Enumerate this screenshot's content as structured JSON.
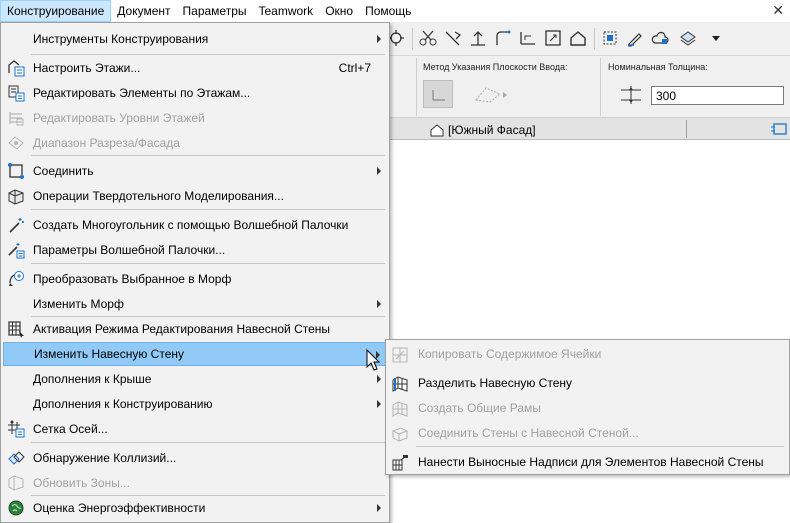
{
  "menubar": {
    "items": [
      {
        "label": "Конструирование"
      },
      {
        "label": "Документ"
      },
      {
        "label": "Параметры"
      },
      {
        "label": "Teamwork"
      },
      {
        "label": "Окно"
      },
      {
        "label": "Помощь"
      }
    ],
    "close_glyph": "✕"
  },
  "menu": {
    "items": [
      {
        "label": "Инструменты Конструирования",
        "icon": "none",
        "submenu": true
      },
      {
        "label": "Настроить Этажи...",
        "shortcut": "Ctrl+7",
        "icon": "stories-icon"
      },
      {
        "label": "Редактировать Элементы по Этажам...",
        "icon": "edit-by-story-icon"
      },
      {
        "label": "Редактировать Уровни Этажей",
        "icon": "story-levels-icon",
        "disabled": true
      },
      {
        "label": "Диапазон Разреза/Фасада",
        "icon": "section-range-icon",
        "disabled": true
      },
      {
        "label": "Соединить",
        "icon": "connect-icon",
        "submenu": true
      },
      {
        "label": "Операции Твердотельного Моделирования...",
        "icon": "solid-ops-icon"
      },
      {
        "label": "Создать Многоугольник с помощью Волшебной Палочки",
        "icon": "magic-wand-icon"
      },
      {
        "label": "Параметры Волшебной Палочки...",
        "icon": "magic-wand-settings-icon"
      },
      {
        "label": "Преобразовать Выбранное в Морф",
        "icon": "morph-convert-icon"
      },
      {
        "label": "Изменить Морф",
        "icon": "none",
        "submenu": true
      },
      {
        "label": "Активация Режима Редактирования Навесной Стены",
        "icon": "curtain-wall-edit-icon"
      },
      {
        "label": "Изменить Навесную Стену",
        "icon": "none",
        "submenu": true,
        "highlighted": true
      },
      {
        "label": "Дополнения к Крыше",
        "icon": "none",
        "submenu": true
      },
      {
        "label": "Дополнения к Конструированию",
        "icon": "none",
        "submenu": true
      },
      {
        "label": "Сетка Осей...",
        "icon": "grid-icon"
      },
      {
        "label": "Обнаружение Коллизий...",
        "icon": "collision-icon"
      },
      {
        "label": "Обновить Зоны...",
        "icon": "zones-icon",
        "disabled": true
      },
      {
        "label": "Оценка Энергоэффективности",
        "icon": "energy-icon",
        "submenu": true
      }
    ]
  },
  "submenu": {
    "items": [
      {
        "label": "Копировать Содержимое Ячейки",
        "icon": "copy-cell-icon",
        "disabled": true
      },
      {
        "label": "Разделить Навесную Стену",
        "icon": "split-cw-icon"
      },
      {
        "label": "Создать Общие Рамы",
        "icon": "common-frames-icon",
        "disabled": true
      },
      {
        "label": "Соединить Стены с Навесной Стеной...",
        "icon": "join-walls-icon",
        "disabled": true
      },
      {
        "label": "Нанести Выносные Надписи для Элементов Навесной Стены",
        "icon": "labels-icon"
      }
    ]
  },
  "infobox": {
    "plane_label": "Метод Указания Плоскости Ввода:",
    "thickness_label": "Номинальная Толщина:",
    "thickness_value": "300"
  },
  "tab": {
    "label": "[Южный Фасад]"
  },
  "colors": {
    "highlight": "#91c9f7",
    "menubar_active": "#cce8ff",
    "disabled_text": "#a0a0a0"
  }
}
